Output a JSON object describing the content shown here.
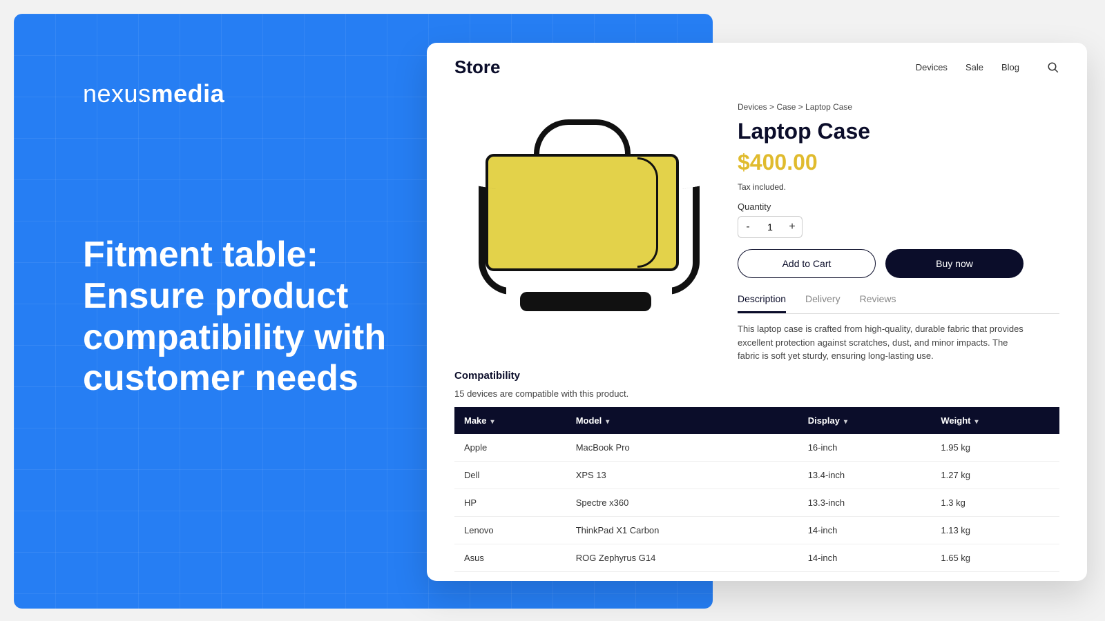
{
  "brand": {
    "thin": "nexus",
    "bold": "media"
  },
  "headline": "Fitment table: Ensure product compatibility with customer needs",
  "store": {
    "name": "Store",
    "nav": [
      "Devices",
      "Sale",
      "Blog"
    ],
    "breadcrumb": "Devices > Case > Laptop Case",
    "product_title": "Laptop Case",
    "price": "$400.00",
    "tax_note": "Tax included.",
    "qty_label": "Quantity",
    "qty_value": "1",
    "add_to_cart": "Add to Cart",
    "buy_now": "Buy now",
    "tabs": {
      "description": "Description",
      "delivery": "Delivery",
      "reviews": "Reviews"
    },
    "description_text": "This laptop case is crafted from high-quality, durable fabric that provides excellent protection against scratches, dust, and minor impacts. The fabric is soft yet sturdy, ensuring long-lasting use.",
    "compat_heading": "Compatibility",
    "compat_note": "15 devices are compatible with this product.",
    "columns": {
      "make": "Make",
      "model": "Model",
      "display": "Display",
      "weight": "Weight"
    },
    "rows": [
      {
        "make": "Apple",
        "model": "MacBook Pro",
        "display": "16-inch",
        "weight": "1.95 kg"
      },
      {
        "make": "Dell",
        "model": "XPS 13",
        "display": "13.4-inch",
        "weight": "1.27 kg"
      },
      {
        "make": "HP",
        "model": "Spectre x360",
        "display": "13.3-inch",
        "weight": "1.3 kg"
      },
      {
        "make": "Lenovo",
        "model": "ThinkPad X1 Carbon",
        "display": "14-inch",
        "weight": "1.13 kg"
      },
      {
        "make": "Asus",
        "model": "ROG Zephyrus G14",
        "display": "14-inch",
        "weight": "1.65 kg"
      }
    ]
  }
}
